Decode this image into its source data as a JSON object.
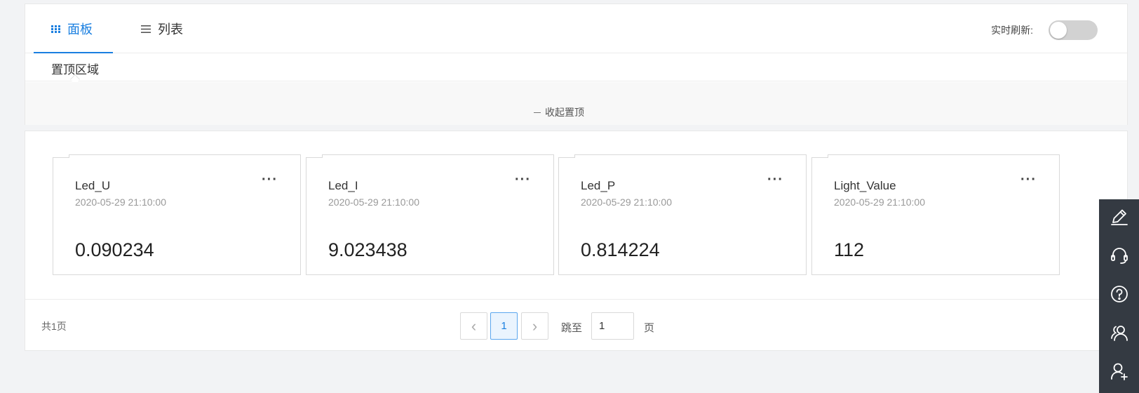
{
  "tabs": [
    {
      "label": "面板",
      "icon": "grid-icon",
      "active": true
    },
    {
      "label": "列表",
      "icon": "list-icon",
      "active": false
    }
  ],
  "realtime_refresh": {
    "label": "实时刷新:",
    "enabled": false
  },
  "pinned": {
    "label": "置顶区域",
    "collapse_label": "收起置顶"
  },
  "cards": [
    {
      "name": "Led_U",
      "time": "2020-05-29 21:10:00",
      "value": "0.090234",
      "menu": "···"
    },
    {
      "name": "Led_I",
      "time": "2020-05-29 21:10:00",
      "value": "9.023438",
      "menu": "···"
    },
    {
      "name": "Led_P",
      "time": "2020-05-29 21:10:00",
      "value": "0.814224",
      "menu": "···"
    },
    {
      "name": "Light_Value",
      "time": "2020-05-29 21:10:00",
      "value": "112",
      "menu": "···"
    }
  ],
  "pagination": {
    "total_text": "共1页",
    "prev": "‹",
    "current": "1",
    "next": "›",
    "jump_label": "跳至",
    "jump_value": "1",
    "page_suffix": "页"
  },
  "side_toolbar": [
    "edit-icon",
    "headset-icon",
    "help-icon",
    "users-icon",
    "add-user-icon"
  ],
  "colors": {
    "accent": "#1a7fe0",
    "sidebar": "#343a42",
    "toggle_off": "#d2d2d2"
  }
}
